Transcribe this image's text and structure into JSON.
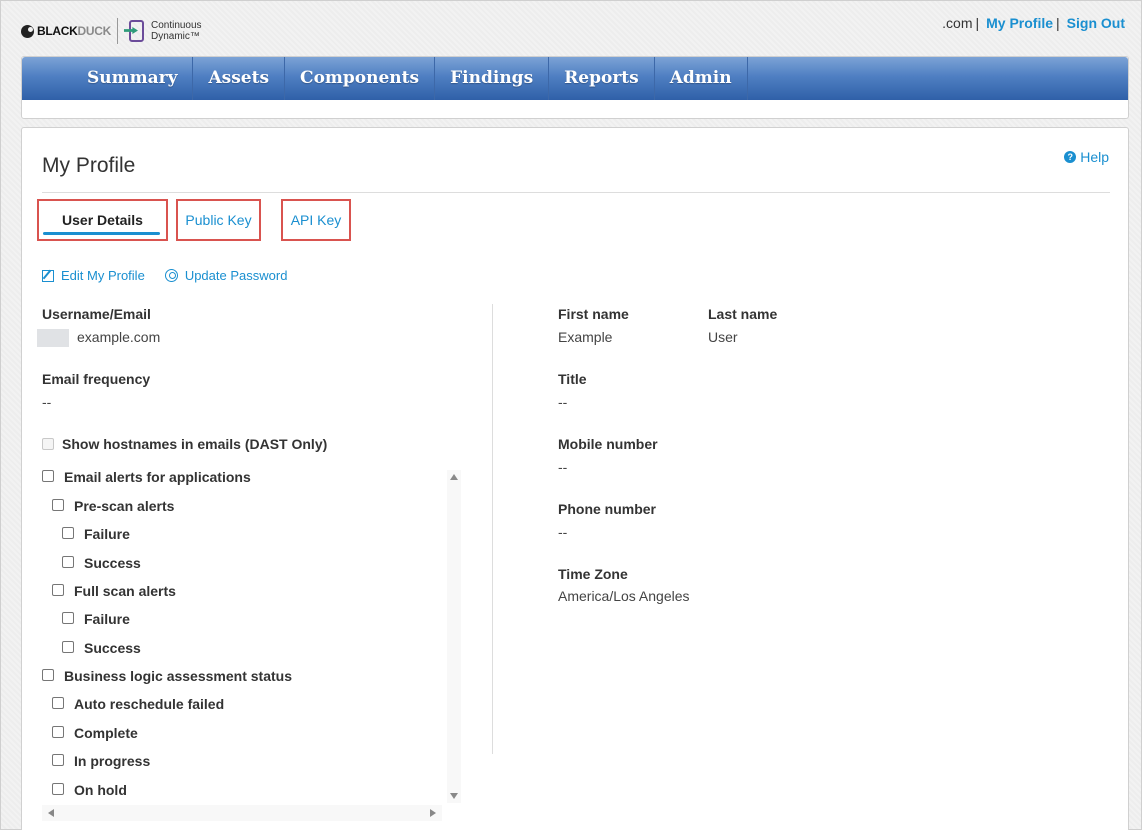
{
  "brand": {
    "blackduck_bold": "BLACK",
    "blackduck_light": "DUCK",
    "product_line1": "Continuous",
    "product_line2": "Dynamic™"
  },
  "userbar": {
    "org": ".com",
    "sep1": "|",
    "my_profile": "My Profile",
    "sep2": "|",
    "sign_out": "Sign Out"
  },
  "nav": {
    "items": [
      "Summary",
      "Assets",
      "Components",
      "Findings",
      "Reports",
      "Admin"
    ]
  },
  "page": {
    "title": "My Profile",
    "help": "Help",
    "help_glyph": "?"
  },
  "tabs": {
    "user_details": "User Details",
    "public_key": "Public Key",
    "api_key": "API Key"
  },
  "actions": {
    "edit_profile": "Edit My Profile",
    "update_password": "Update Password"
  },
  "left": {
    "username_label": "Username/Email",
    "username_value": "example.com",
    "email_freq_label": "Email frequency",
    "email_freq_value": "--",
    "show_hostnames": "Show hostnames in emails (DAST Only)"
  },
  "alerts": {
    "email_alerts": "Email alerts for applications",
    "pre_scan": "Pre-scan alerts",
    "pre_failure": "Failure",
    "pre_success": "Success",
    "full_scan": "Full scan alerts",
    "full_failure": "Failure",
    "full_success": "Success",
    "bla_status": "Business logic assessment status",
    "auto_reschedule": "Auto reschedule failed",
    "complete": "Complete",
    "in_progress": "In progress",
    "on_hold": "On hold"
  },
  "right": {
    "first_name_label": "First name",
    "first_name_value": "Example",
    "last_name_label": "Last name",
    "last_name_value": "User",
    "title_label": "Title",
    "title_value": "--",
    "mobile_label": "Mobile number",
    "mobile_value": "--",
    "phone_label": "Phone number",
    "phone_value": "--",
    "tz_label": "Time Zone",
    "tz_value": "America/Los Angeles"
  },
  "colors": {
    "link": "#1a8fd0",
    "highlight": "#d9534f",
    "nav_top": "#7ca3d6",
    "nav_bottom": "#2f60a8"
  }
}
